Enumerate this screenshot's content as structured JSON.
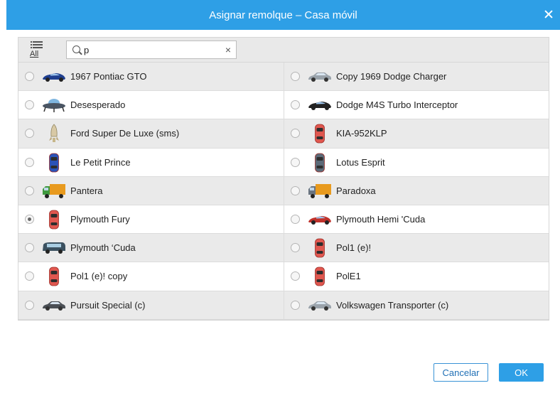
{
  "dialog": {
    "title": "Asignar remolque – Casa móvil",
    "close_icon": "close-icon"
  },
  "toolbar": {
    "all_label": "All",
    "all_icon": "list-icon",
    "search_value": "p",
    "search_icon": "search-icon",
    "clear_icon": "clear-icon"
  },
  "units": [
    {
      "name": "1967 Pontiac GTO",
      "icon": "sports-car-icon",
      "selected": false
    },
    {
      "name": "Copy 1969 Dodge Charger",
      "icon": "car-icon",
      "selected": false
    },
    {
      "name": "Desesperado",
      "icon": "ufo-icon",
      "selected": false
    },
    {
      "name": "Dodge M4S Turbo Interceptor",
      "icon": "sports-car-icon",
      "selected": false
    },
    {
      "name": "Ford Super De Luxe (sms)",
      "icon": "rocket-icon",
      "selected": false
    },
    {
      "name": "KIA-952KLP",
      "icon": "car-top-view-icon",
      "selected": false
    },
    {
      "name": "Le Petit Prince",
      "icon": "car-top-view-icon",
      "selected": false
    },
    {
      "name": "Lotus Esprit",
      "icon": "car-top-view-icon",
      "selected": false
    },
    {
      "name": "Pantera",
      "icon": "truck-icon",
      "selected": false
    },
    {
      "name": "Paradoxa",
      "icon": "truck-icon",
      "selected": false
    },
    {
      "name": "Plymouth Fury",
      "icon": "car-top-view-icon",
      "selected": true
    },
    {
      "name": "Plymouth Hemi 'Cuda",
      "icon": "sports-car-icon",
      "selected": false
    },
    {
      "name": "Plymouth ‘Cuda",
      "icon": "bus-icon",
      "selected": false
    },
    {
      "name": "Pol1 (e)!",
      "icon": "car-top-view-icon",
      "selected": false
    },
    {
      "name": "Pol1 (e)! copy",
      "icon": "car-top-view-icon",
      "selected": false
    },
    {
      "name": "PolE1",
      "icon": "car-top-view-icon",
      "selected": false
    },
    {
      "name": "Pursuit Special (c)",
      "icon": "car-icon",
      "selected": false
    },
    {
      "name": "Volkswagen Transporter (c)",
      "icon": "car-icon",
      "selected": false
    }
  ],
  "buttons": {
    "cancel": "Cancelar",
    "ok": "OK"
  },
  "colors": {
    "accent": "#2e9fe6",
    "row_alt": "#eaeaea"
  }
}
